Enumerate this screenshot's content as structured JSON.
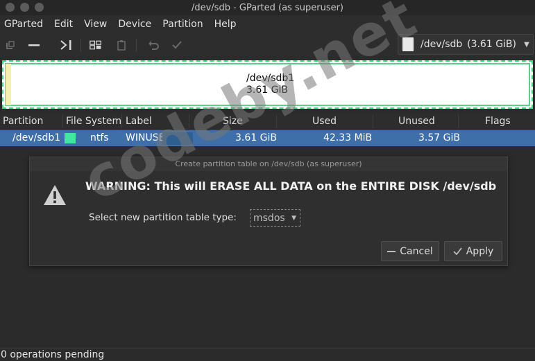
{
  "window": {
    "title": "/dev/sdb - GParted (as superuser)"
  },
  "menubar": {
    "items": [
      "GParted",
      "Edit",
      "View",
      "Device",
      "Partition",
      "Help"
    ]
  },
  "toolbar": {
    "icons": [
      "new-partition-icon",
      "delete-icon",
      "resize-move-icon",
      "copy-icon",
      "paste-icon",
      "undo-icon",
      "apply-icon"
    ]
  },
  "device": {
    "name": "/dev/sdb",
    "size": "(3.61 GiB)"
  },
  "disk_map": {
    "name": "/dev/sdb1",
    "size": "3.61 GiB"
  },
  "table": {
    "headers": [
      "Partition",
      "File System",
      "Label",
      "Size",
      "Used",
      "Unused",
      "Flags"
    ],
    "rows": [
      {
        "partition": "/dev/sdb1",
        "fs": "ntfs",
        "fs_color": "#42e6a4",
        "label": "WINUSB",
        "size": "3.61 GiB",
        "used": "42.33 MiB",
        "unused": "3.57 GiB",
        "flags": ""
      }
    ]
  },
  "dialog": {
    "title": "Create partition table on /dev/sdb (as superuser)",
    "warning": "WARNING:  This will ERASE ALL DATA on the ENTIRE DISK /dev/sdb",
    "select_label": "Select new partition table type:",
    "select_value": "msdos",
    "cancel_label": "Cancel",
    "apply_label": "Apply"
  },
  "status": {
    "text": "0 operations pending"
  },
  "watermark": {
    "text": "codeby.net"
  },
  "colors": {
    "selection": "#3f6fa8",
    "accent_green": "#3ddc84"
  }
}
